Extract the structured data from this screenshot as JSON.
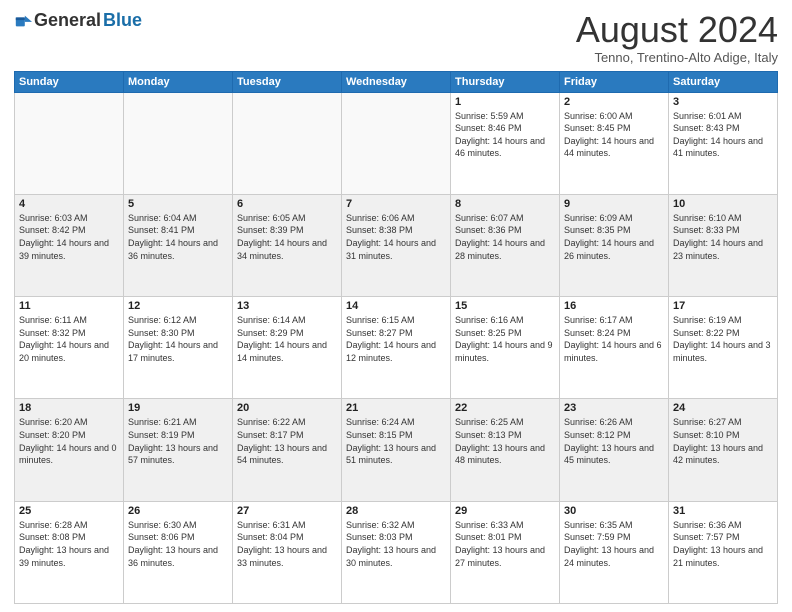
{
  "logo": {
    "general": "General",
    "blue": "Blue"
  },
  "title": "August 2024",
  "location": "Tenno, Trentino-Alto Adige, Italy",
  "days_of_week": [
    "Sunday",
    "Monday",
    "Tuesday",
    "Wednesday",
    "Thursday",
    "Friday",
    "Saturday"
  ],
  "weeks": [
    [
      {
        "day": "",
        "info": ""
      },
      {
        "day": "",
        "info": ""
      },
      {
        "day": "",
        "info": ""
      },
      {
        "day": "",
        "info": ""
      },
      {
        "day": "1",
        "info": "Sunrise: 5:59 AM\nSunset: 8:46 PM\nDaylight: 14 hours and 46 minutes."
      },
      {
        "day": "2",
        "info": "Sunrise: 6:00 AM\nSunset: 8:45 PM\nDaylight: 14 hours and 44 minutes."
      },
      {
        "day": "3",
        "info": "Sunrise: 6:01 AM\nSunset: 8:43 PM\nDaylight: 14 hours and 41 minutes."
      }
    ],
    [
      {
        "day": "4",
        "info": "Sunrise: 6:03 AM\nSunset: 8:42 PM\nDaylight: 14 hours and 39 minutes."
      },
      {
        "day": "5",
        "info": "Sunrise: 6:04 AM\nSunset: 8:41 PM\nDaylight: 14 hours and 36 minutes."
      },
      {
        "day": "6",
        "info": "Sunrise: 6:05 AM\nSunset: 8:39 PM\nDaylight: 14 hours and 34 minutes."
      },
      {
        "day": "7",
        "info": "Sunrise: 6:06 AM\nSunset: 8:38 PM\nDaylight: 14 hours and 31 minutes."
      },
      {
        "day": "8",
        "info": "Sunrise: 6:07 AM\nSunset: 8:36 PM\nDaylight: 14 hours and 28 minutes."
      },
      {
        "day": "9",
        "info": "Sunrise: 6:09 AM\nSunset: 8:35 PM\nDaylight: 14 hours and 26 minutes."
      },
      {
        "day": "10",
        "info": "Sunrise: 6:10 AM\nSunset: 8:33 PM\nDaylight: 14 hours and 23 minutes."
      }
    ],
    [
      {
        "day": "11",
        "info": "Sunrise: 6:11 AM\nSunset: 8:32 PM\nDaylight: 14 hours and 20 minutes."
      },
      {
        "day": "12",
        "info": "Sunrise: 6:12 AM\nSunset: 8:30 PM\nDaylight: 14 hours and 17 minutes."
      },
      {
        "day": "13",
        "info": "Sunrise: 6:14 AM\nSunset: 8:29 PM\nDaylight: 14 hours and 14 minutes."
      },
      {
        "day": "14",
        "info": "Sunrise: 6:15 AM\nSunset: 8:27 PM\nDaylight: 14 hours and 12 minutes."
      },
      {
        "day": "15",
        "info": "Sunrise: 6:16 AM\nSunset: 8:25 PM\nDaylight: 14 hours and 9 minutes."
      },
      {
        "day": "16",
        "info": "Sunrise: 6:17 AM\nSunset: 8:24 PM\nDaylight: 14 hours and 6 minutes."
      },
      {
        "day": "17",
        "info": "Sunrise: 6:19 AM\nSunset: 8:22 PM\nDaylight: 14 hours and 3 minutes."
      }
    ],
    [
      {
        "day": "18",
        "info": "Sunrise: 6:20 AM\nSunset: 8:20 PM\nDaylight: 14 hours and 0 minutes."
      },
      {
        "day": "19",
        "info": "Sunrise: 6:21 AM\nSunset: 8:19 PM\nDaylight: 13 hours and 57 minutes."
      },
      {
        "day": "20",
        "info": "Sunrise: 6:22 AM\nSunset: 8:17 PM\nDaylight: 13 hours and 54 minutes."
      },
      {
        "day": "21",
        "info": "Sunrise: 6:24 AM\nSunset: 8:15 PM\nDaylight: 13 hours and 51 minutes."
      },
      {
        "day": "22",
        "info": "Sunrise: 6:25 AM\nSunset: 8:13 PM\nDaylight: 13 hours and 48 minutes."
      },
      {
        "day": "23",
        "info": "Sunrise: 6:26 AM\nSunset: 8:12 PM\nDaylight: 13 hours and 45 minutes."
      },
      {
        "day": "24",
        "info": "Sunrise: 6:27 AM\nSunset: 8:10 PM\nDaylight: 13 hours and 42 minutes."
      }
    ],
    [
      {
        "day": "25",
        "info": "Sunrise: 6:28 AM\nSunset: 8:08 PM\nDaylight: 13 hours and 39 minutes."
      },
      {
        "day": "26",
        "info": "Sunrise: 6:30 AM\nSunset: 8:06 PM\nDaylight: 13 hours and 36 minutes."
      },
      {
        "day": "27",
        "info": "Sunrise: 6:31 AM\nSunset: 8:04 PM\nDaylight: 13 hours and 33 minutes."
      },
      {
        "day": "28",
        "info": "Sunrise: 6:32 AM\nSunset: 8:03 PM\nDaylight: 13 hours and 30 minutes."
      },
      {
        "day": "29",
        "info": "Sunrise: 6:33 AM\nSunset: 8:01 PM\nDaylight: 13 hours and 27 minutes."
      },
      {
        "day": "30",
        "info": "Sunrise: 6:35 AM\nSunset: 7:59 PM\nDaylight: 13 hours and 24 minutes."
      },
      {
        "day": "31",
        "info": "Sunrise: 6:36 AM\nSunset: 7:57 PM\nDaylight: 13 hours and 21 minutes."
      }
    ]
  ]
}
